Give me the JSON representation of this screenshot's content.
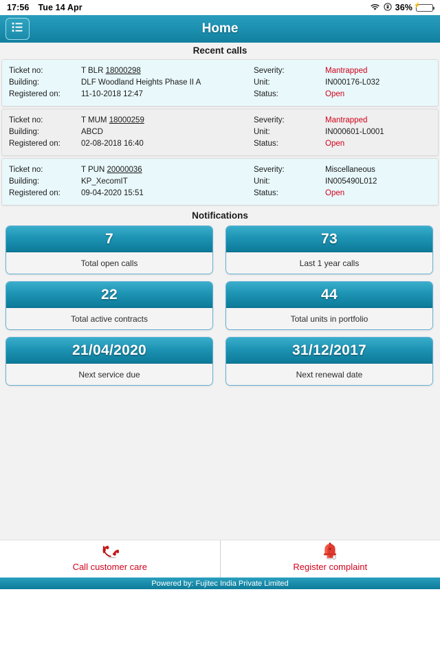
{
  "statusbar": {
    "time": "17:56",
    "date": "Tue 14 Apr",
    "battery_percent": "36%",
    "wifi_icon": "wifi-icon",
    "rotation_lock_icon": "rotation-lock-icon",
    "battery_icon": "battery-charging-icon"
  },
  "header": {
    "title": "Home",
    "menu_icon": "list-menu-icon"
  },
  "sections": {
    "recent_calls_title": "Recent calls",
    "notifications_title": "Notifications"
  },
  "labels": {
    "ticket_no": "Ticket no:",
    "building": "Building:",
    "registered_on": "Registered on:",
    "severity": "Severity:",
    "unit": "Unit:",
    "status": "Status:"
  },
  "recent_calls": [
    {
      "ticket_prefix": "T BLR",
      "ticket_id": "18000298",
      "building": "DLF Woodland Heights Phase II A",
      "registered_on": "11-10-2018 12:47",
      "severity": "Mantrapped",
      "unit": "IN000176-L032",
      "status": "Open"
    },
    {
      "ticket_prefix": "T MUM",
      "ticket_id": "18000259",
      "building": "ABCD",
      "registered_on": "02-08-2018 16:40",
      "severity": "Mantrapped",
      "unit": "IN000601-L0001",
      "status": "Open"
    },
    {
      "ticket_prefix": "T PUN",
      "ticket_id": "20000036",
      "building": "KP_XecomIT",
      "registered_on": "09-04-2020 15:51",
      "severity": "Miscellaneous",
      "unit": "IN005490L012",
      "status": "Open"
    }
  ],
  "notification_tiles": [
    {
      "value": "7",
      "label": "Total open calls"
    },
    {
      "value": "73",
      "label": "Last 1 year calls"
    },
    {
      "value": "22",
      "label": "Total active contracts"
    },
    {
      "value": "44",
      "label": "Total units in portfolio"
    },
    {
      "value": "21/04/2020",
      "label": "Next service due"
    },
    {
      "value": "31/12/2017",
      "label": "Next renewal date"
    }
  ],
  "actions": [
    {
      "label": "Call customer care",
      "icon": "phone-handset-icon"
    },
    {
      "label": "Register complaint",
      "icon": "alarm-bell-icon"
    }
  ],
  "footer": {
    "powered_by": "Powered by: Fujitec India Private Limited"
  },
  "colors": {
    "teal_light": "#2fa3c0",
    "teal_dark": "#0d7a99",
    "accent_red": "#d0021b",
    "tile_border": "#65aed4",
    "page_bg": "#f2f2f2"
  }
}
